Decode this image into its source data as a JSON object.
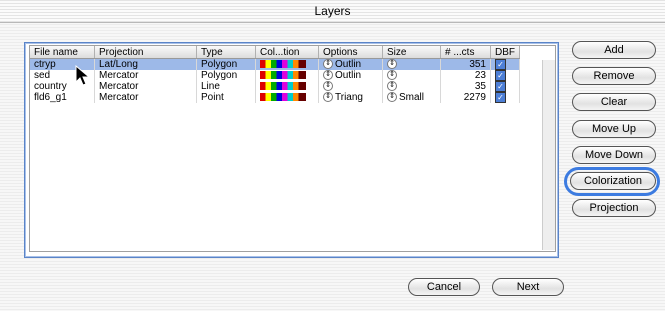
{
  "window": {
    "title": "Layers"
  },
  "table": {
    "headers": [
      "File name",
      "Projection",
      "Type",
      "Col...tion",
      "Options",
      "Size",
      "# ...cts",
      "DBF"
    ],
    "rows": [
      {
        "file": "ctryp",
        "projection": "Lat/Long",
        "type": "Polygon",
        "options": "Outlin",
        "size": "",
        "count": "351",
        "dbf": true,
        "selected": true
      },
      {
        "file": "sed",
        "projection": "Mercator",
        "type": "Polygon",
        "options": "Outlin",
        "size": "",
        "count": "23",
        "dbf": true,
        "selected": false
      },
      {
        "file": "country",
        "projection": "Mercator",
        "type": "Line",
        "options": "",
        "size": "",
        "count": "35",
        "dbf": true,
        "selected": false
      },
      {
        "file": "fld6_g1",
        "projection": "Mercator",
        "type": "Point",
        "options": "Triang",
        "size": "Small",
        "count": "2279",
        "dbf": true,
        "selected": false
      }
    ]
  },
  "buttons": {
    "add": "Add",
    "remove": "Remove",
    "clear": "Clear",
    "move_up": "Move Up",
    "move_down": "Move Down",
    "colorization": "Colorization",
    "projection": "Projection",
    "cancel": "Cancel",
    "next": "Next"
  }
}
